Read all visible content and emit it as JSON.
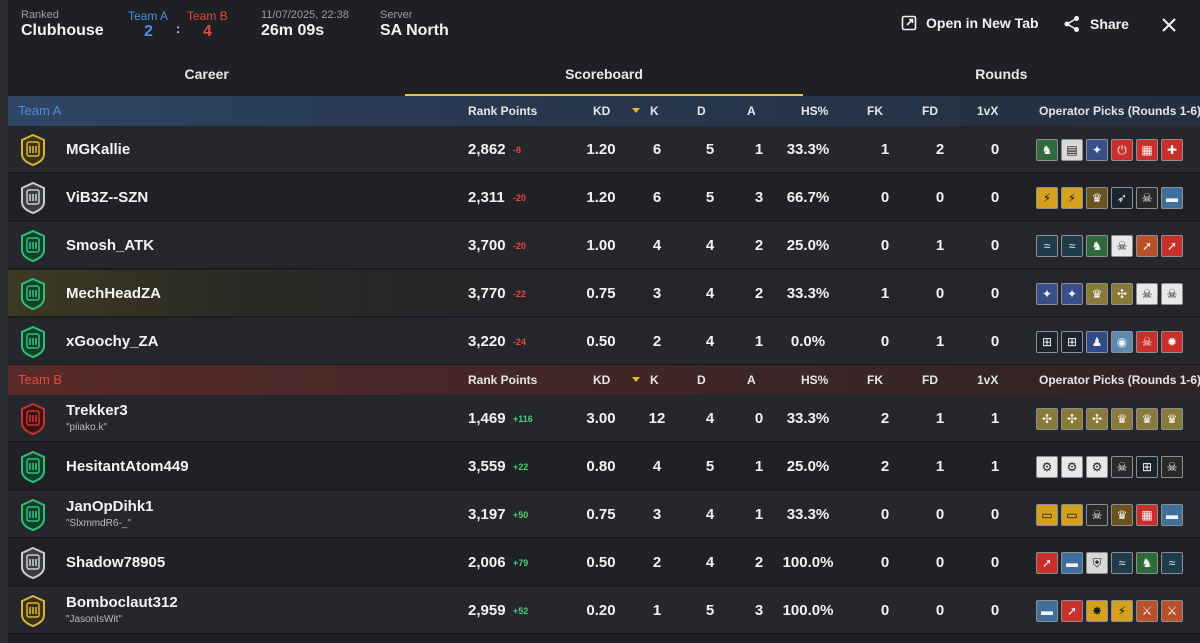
{
  "header": {
    "mode_label": "Ranked",
    "map": "Clubhouse",
    "team_a_label": "Team A",
    "team_b_label": "Team B",
    "team_a_score": "2",
    "team_b_score": "4",
    "score_separator": ":",
    "datetime": "11/07/2025, 22:38",
    "duration": "26m 09s",
    "server_label": "Server",
    "server": "SA North",
    "open_new_tab": "Open in New Tab",
    "share": "Share"
  },
  "tabs": [
    {
      "label": "Career"
    },
    {
      "label": "Scoreboard"
    },
    {
      "label": "Rounds"
    }
  ],
  "active_tab": "Scoreboard",
  "columns": {
    "rank_points": "Rank Points",
    "kd": "KD",
    "k": "K",
    "d": "D",
    "a": "A",
    "hs": "HS%",
    "fk": "FK",
    "fd": "FD",
    "onevx": "1vX",
    "operators": "Operator Picks (Rounds 1-6)"
  },
  "colors": {
    "team_a": "#4a8fe0",
    "team_b": "#e5483f",
    "positive": "#4bd07a",
    "negative": "#e5483f",
    "accent": "#e8c24a"
  },
  "team_a": {
    "name": "Team A",
    "players": [
      {
        "name": "MGKallie",
        "sub": "",
        "rank_icon": "gold-rank-icon",
        "rp": "2,862",
        "delta": "-8",
        "kd": "1.20",
        "k": "6",
        "d": "5",
        "a": "1",
        "hs": "33.3%",
        "fk": "1",
        "fd": "2",
        "onevx": "0",
        "ops": [
          [
            "#2e6b3a",
            "♞"
          ],
          [
            "#d8d8d8",
            "▤"
          ],
          [
            "#3a4e8a",
            "✦"
          ],
          [
            "#c9302c",
            "⏻"
          ],
          [
            "#c9302c",
            "▦"
          ],
          [
            "#c9302c",
            "✚"
          ]
        ]
      },
      {
        "name": "ViB3Z--SZN",
        "sub": "",
        "rank_icon": "silver-rank-icon",
        "rp": "2,311",
        "delta": "-20",
        "kd": "1.20",
        "k": "6",
        "d": "5",
        "a": "3",
        "hs": "66.7%",
        "fk": "0",
        "fd": "0",
        "onevx": "0",
        "ops": [
          [
            "#d6a21e",
            "⚡"
          ],
          [
            "#d6a21e",
            "⚡"
          ],
          [
            "#6b5320",
            "♛"
          ],
          [
            "#1c2430",
            "➶"
          ],
          [
            "#2a2a2a",
            "☠"
          ],
          [
            "#3f6f9a",
            "▬"
          ]
        ]
      },
      {
        "name": "Smosh_ATK",
        "sub": "",
        "rank_icon": "emerald-rank-icon",
        "rp": "3,700",
        "delta": "-20",
        "kd": "1.00",
        "k": "4",
        "d": "4",
        "a": "2",
        "hs": "25.0%",
        "fk": "0",
        "fd": "1",
        "onevx": "0",
        "ops": [
          [
            "#1f3c4a",
            "≈"
          ],
          [
            "#1f3c4a",
            "≈"
          ],
          [
            "#2e6b3a",
            "♞"
          ],
          [
            "#e8e8e8",
            "☠"
          ],
          [
            "#b8502a",
            "➚"
          ],
          [
            "#c9302c",
            "➚"
          ]
        ]
      },
      {
        "name": "MechHeadZA",
        "sub": "",
        "rank_icon": "emerald-rank-icon",
        "rp": "3,770",
        "delta": "-22",
        "kd": "0.75",
        "k": "3",
        "d": "4",
        "a": "2",
        "hs": "33.3%",
        "fk": "1",
        "fd": "0",
        "onevx": "0",
        "ops": [
          [
            "#3a4e8a",
            "✦"
          ],
          [
            "#3a4e8a",
            "✦"
          ],
          [
            "#8a7a3a",
            "♛"
          ],
          [
            "#8a7a3a",
            "✣"
          ],
          [
            "#e8e8e8",
            "☠"
          ],
          [
            "#e8e8e8",
            "☠"
          ]
        ]
      },
      {
        "name": "xGoochy_ZA",
        "sub": "",
        "rank_icon": "emerald-rank-icon",
        "rp": "3,220",
        "delta": "-24",
        "kd": "0.50",
        "k": "2",
        "d": "4",
        "a": "1",
        "hs": "0.0%",
        "fk": "0",
        "fd": "1",
        "onevx": "0",
        "ops": [
          [
            "#1c2430",
            "⊞"
          ],
          [
            "#1c2430",
            "⊞"
          ],
          [
            "#2f4c86",
            "♟"
          ],
          [
            "#5a8ab0",
            "◉"
          ],
          [
            "#c9302c",
            "☠"
          ],
          [
            "#c9302c",
            "✹"
          ]
        ]
      }
    ]
  },
  "team_b": {
    "name": "Team B",
    "players": [
      {
        "name": "Trekker3",
        "sub": "\"piiako.k\"",
        "rank_icon": "copper-rank-icon",
        "rp": "1,469",
        "delta": "+116",
        "kd": "3.00",
        "k": "12",
        "d": "4",
        "a": "0",
        "hs": "33.3%",
        "fk": "2",
        "fd": "1",
        "onevx": "1",
        "ops": [
          [
            "#8a7a3a",
            "✣"
          ],
          [
            "#8a7a3a",
            "✣"
          ],
          [
            "#8a7a3a",
            "✣"
          ],
          [
            "#8a7a3a",
            "♛"
          ],
          [
            "#8a7a3a",
            "♛"
          ],
          [
            "#8a7a3a",
            "♛"
          ]
        ]
      },
      {
        "name": "HesitantAtom449",
        "sub": "",
        "rank_icon": "emerald-rank-icon",
        "rp": "3,559",
        "delta": "+22",
        "kd": "0.80",
        "k": "4",
        "d": "5",
        "a": "1",
        "hs": "25.0%",
        "fk": "2",
        "fd": "1",
        "onevx": "1",
        "ops": [
          [
            "#e8e8e8",
            "⚙"
          ],
          [
            "#e8e8e8",
            "⚙"
          ],
          [
            "#e8e8e8",
            "⚙"
          ],
          [
            "#2a2a2a",
            "☠"
          ],
          [
            "#1c2430",
            "⊞"
          ],
          [
            "#2a2a2a",
            "☠"
          ]
        ]
      },
      {
        "name": "JanOpDihk1",
        "sub": "\"SlxmmdR6-_\"",
        "rank_icon": "emerald-rank-icon",
        "rp": "3,197",
        "delta": "+50",
        "kd": "0.75",
        "k": "3",
        "d": "4",
        "a": "1",
        "hs": "33.3%",
        "fk": "0",
        "fd": "0",
        "onevx": "0",
        "ops": [
          [
            "#d6a21e",
            "▭"
          ],
          [
            "#d6a21e",
            "▭"
          ],
          [
            "#2a2a2a",
            "☠"
          ],
          [
            "#6b5320",
            "♛"
          ],
          [
            "#c9302c",
            "▦"
          ],
          [
            "#3f6f9a",
            "▬"
          ]
        ]
      },
      {
        "name": "Shadow78905",
        "sub": "",
        "rank_icon": "silver-rank-icon",
        "rp": "2,006",
        "delta": "+79",
        "kd": "0.50",
        "k": "2",
        "d": "4",
        "a": "2",
        "hs": "100.0%",
        "fk": "0",
        "fd": "0",
        "onevx": "0",
        "ops": [
          [
            "#c9302c",
            "➚"
          ],
          [
            "#3f6f9a",
            "▬"
          ],
          [
            "#d8d8d8",
            "⛨"
          ],
          [
            "#1f3c4a",
            "≈"
          ],
          [
            "#2e6b3a",
            "♞"
          ],
          [
            "#1f3c4a",
            "≈"
          ]
        ]
      },
      {
        "name": "Bomboclaut312",
        "sub": "\"JasonIsWit\"",
        "rank_icon": "gold-rank-icon",
        "rp": "2,959",
        "delta": "+52",
        "kd": "0.20",
        "k": "1",
        "d": "5",
        "a": "3",
        "hs": "100.0%",
        "fk": "0",
        "fd": "0",
        "onevx": "0",
        "ops": [
          [
            "#3f6f9a",
            "▬"
          ],
          [
            "#c9302c",
            "➚"
          ],
          [
            "#d6a21e",
            "✸"
          ],
          [
            "#d6a21e",
            "⚡"
          ],
          [
            "#b8502a",
            "⚔"
          ],
          [
            "#b8502a",
            "⚔"
          ]
        ]
      }
    ]
  }
}
